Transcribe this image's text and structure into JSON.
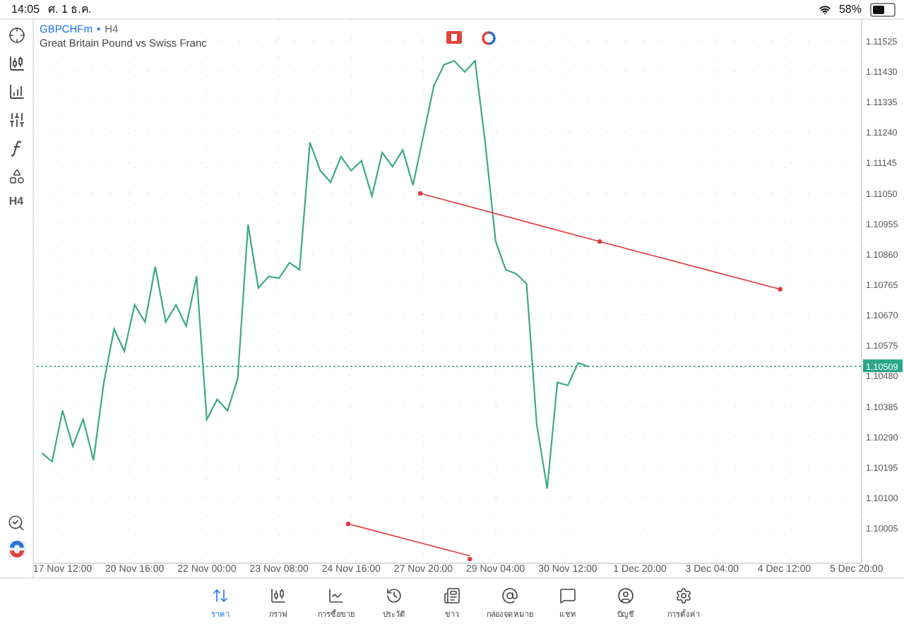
{
  "status_bar": {
    "time": "14:05",
    "date": "ศ. 1 ธ.ค.",
    "battery": "58%"
  },
  "toolbar": {
    "timeframe": "H4"
  },
  "chart": {
    "symbol": "GBPCHFm",
    "separator": "•",
    "period": "H4",
    "description": "Great Britain Pound vs Swiss Franc",
    "current_price": "1.10509",
    "chart_data": {
      "type": "line",
      "categories": [
        null,
        null,
        "17 Nov 12:00",
        null,
        null,
        null,
        null,
        null,
        null,
        "20 Nov 16:00",
        null,
        null,
        null,
        null,
        null,
        null,
        "22 Nov 00:00",
        null,
        null,
        null,
        null,
        null,
        null,
        "23 Nov 08:00",
        null,
        null,
        null,
        null,
        null,
        null,
        "24 Nov 16:00",
        null,
        null,
        null,
        null,
        null,
        null,
        "27 Nov 20:00",
        null,
        null,
        null,
        null,
        null,
        null,
        "29 Nov 04:00",
        null,
        null,
        null,
        null,
        null,
        null,
        "30 Nov 12:00",
        null,
        null,
        null,
        null,
        null,
        null,
        "1 Dec 20:00",
        null,
        null,
        null,
        null,
        null,
        null,
        "3 Dec 04:00",
        null,
        null,
        null,
        null,
        null,
        null,
        "4 Dec 12:00",
        null,
        null,
        null,
        null,
        null,
        null,
        "5 Dec 20:00"
      ],
      "series": [
        {
          "color": "#3daa7f",
          "values": [
            1.10239,
            1.10212,
            1.10371,
            1.1026,
            1.10344,
            1.10216,
            1.10459,
            1.10626,
            1.10556,
            1.10701,
            1.10648,
            1.1082,
            1.10648,
            1.10701,
            1.10635,
            1.1079,
            1.10344,
            1.10406,
            1.10371,
            1.10472,
            1.10952,
            1.10754,
            1.1079,
            1.10785,
            1.10833,
            1.10811,
            1.11208,
            1.1112,
            1.11084,
            1.11164,
            1.1112,
            1.11151,
            1.11041,
            1.11177,
            1.11133,
            1.11185,
            1.11075,
            1.1123,
            1.11384,
            1.11451,
            1.11463,
            1.11428,
            1.11463,
            1.11208,
            1.10899,
            1.10811,
            1.10798,
            1.10767,
            1.10327,
            1.10128,
            1.10459,
            1.1045,
            1.1052,
            1.10509,
            null,
            null,
            null,
            null,
            null,
            null,
            null,
            null,
            null,
            null,
            null,
            null,
            null,
            null,
            null,
            null,
            null,
            null,
            null,
            null,
            null,
            null,
            null,
            null,
            null,
            null
          ]
        }
      ],
      "ylim": [
        1.09895,
        1.11591
      ],
      "grid": true,
      "ref_lines": [
        {
          "axis": "y",
          "value": 1.10509,
          "color": "#2aa58a"
        }
      ],
      "yticks": [
        {
          "value": 1.11525,
          "label": "1.11525"
        },
        {
          "value": 1.1143,
          "label": "1.11430"
        },
        {
          "value": 1.11335,
          "label": "1.11335"
        },
        {
          "value": 1.1124,
          "label": "1.11240"
        },
        {
          "value": 1.11145,
          "label": "1.11145"
        },
        {
          "value": 1.1105,
          "label": "1.11050"
        },
        {
          "value": 1.10955,
          "label": "1.10955"
        },
        {
          "value": 1.1086,
          "label": "1.10860"
        },
        {
          "value": 1.10765,
          "label": "1.10765"
        },
        {
          "value": 1.1067,
          "label": "1.10670"
        },
        {
          "value": 1.10575,
          "label": "1.10575"
        },
        {
          "value": 1.1048,
          "label": "1.10480"
        },
        {
          "value": 1.10385,
          "label": "1.10385"
        },
        {
          "value": 1.1029,
          "label": "1.10290"
        },
        {
          "value": 1.10195,
          "label": "1.10195"
        },
        {
          "value": 1.101,
          "label": "1.10100"
        },
        {
          "value": 1.10005,
          "label": "1.10005"
        }
      ]
    }
  },
  "tabs": [
    {
      "label": "ราคา",
      "selected": true
    },
    {
      "label": "กราฟ",
      "selected": false
    },
    {
      "label": "การซื้อขาย",
      "selected": false
    },
    {
      "label": "ประวัติ",
      "selected": false
    },
    {
      "label": "ข่าว",
      "selected": false
    },
    {
      "label": "กล่องจดหมาย",
      "selected": false
    },
    {
      "label": "แชท",
      "selected": false
    },
    {
      "label": "บัญชี",
      "selected": false
    },
    {
      "label": "การตั้งค่า",
      "selected": false
    }
  ]
}
